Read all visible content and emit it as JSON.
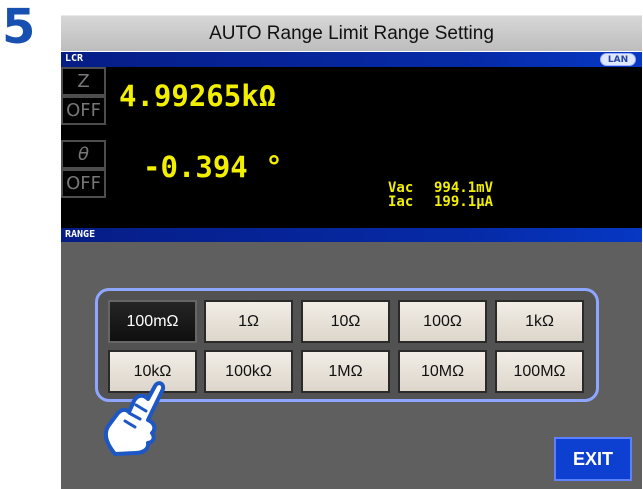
{
  "step": {
    "number": "5"
  },
  "instruction": {
    "title": "AUTO Range Limit Range Setting"
  },
  "status": {
    "mode": "LCR",
    "lan": "LAN"
  },
  "params": [
    {
      "label": "Z"
    },
    {
      "label": "OFF"
    },
    {
      "label": "θ"
    },
    {
      "label": "OFF"
    }
  ],
  "measurements": {
    "primary": "4.99265kΩ",
    "secondary": "-0.394 °"
  },
  "monitor": {
    "vac_label": "Vac",
    "vac_value": "994.1mV",
    "iac_label": "Iac",
    "iac_value": "199.1μA"
  },
  "range": {
    "title": "RANGE",
    "buttons": [
      "100mΩ",
      "1Ω",
      "10Ω",
      "100Ω",
      "1kΩ",
      "10kΩ",
      "100kΩ",
      "1MΩ",
      "10MΩ",
      "100MΩ"
    ],
    "selected": "100mΩ"
  },
  "actions": {
    "exit": "EXIT"
  },
  "colors": {
    "screen": "#000000",
    "header": "#062aa7",
    "value": "#f2ef00",
    "accent": "#0d3fd1"
  },
  "icons": {
    "pointer": "pointing-hand-icon"
  }
}
